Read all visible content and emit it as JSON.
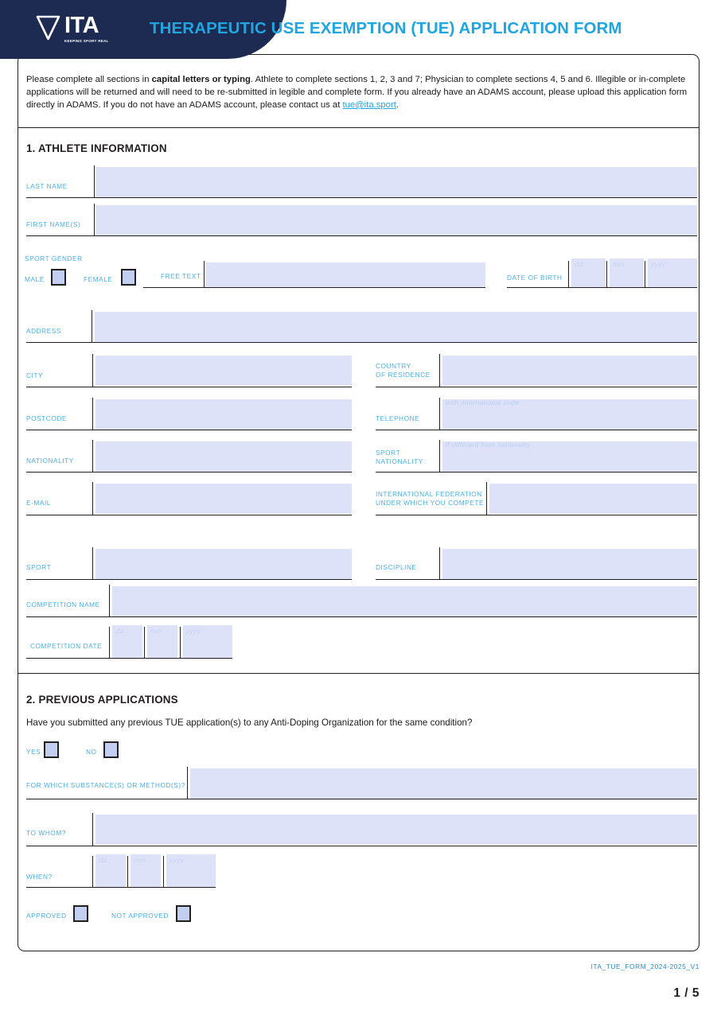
{
  "document": {
    "title": "THERAPEUTIC USE EXEMPTION (TUE) APPLICATION FORM",
    "logo_name": "ITA",
    "logo_tagline": "KEEPING SPORT REAL",
    "doc_code": "ITA_TUE_FORM_2024-2025_V1",
    "page_number": "1 / 5"
  },
  "colors": {
    "brand_navy": "#1d2b53",
    "accent_blue": "#1fa6e0",
    "label_blue": "#4aafe8",
    "field_fill": "#dde2f9",
    "checkbox_fill": "#c3cff1",
    "ink": "#231f20"
  },
  "instructions": {
    "part1": "Please complete all sections in ",
    "bold": "capital letters or typing",
    "part2": ". Athlete to complete sections 1, 2, 3 and 7; Physician to complete sections 4, 5 and 6. Illegible or in-complete applications will be returned and will need to be re-submitted in legible and complete form. If you already have an ADAMS account, please upload this application form directly in ADAMS. If you do not have an ADAMS account, please contact us at ",
    "email": "tue@ita.sport",
    "part3": "."
  },
  "section1": {
    "title": "1. ATHLETE INFORMATION",
    "last_name": {
      "label": "LAST NAME",
      "value": ""
    },
    "first_names": {
      "label": "FIRST NAME(S)",
      "value": ""
    },
    "sport_gender": {
      "label": "SPORT GENDER",
      "male": "MALE",
      "female": "FEMALE",
      "free_text_label": "FREE TEXT",
      "free_text_value": ""
    },
    "date_of_birth": {
      "label": "DATE OF BIRTH",
      "dd_placeholder": "dd",
      "mm_placeholder": "mm",
      "yyyy_placeholder": "yyyy",
      "dd": "",
      "mm": "",
      "yyyy": ""
    },
    "address": {
      "label": "ADDRESS",
      "value": ""
    },
    "city": {
      "label": "CITY",
      "value": ""
    },
    "country_of_residence": {
      "label": "COUNTRY\nOF RESIDENCE",
      "value": ""
    },
    "postcode": {
      "label": "POSTCODE",
      "value": ""
    },
    "telephone": {
      "label": "TELEPHONE",
      "hint": "with international code",
      "value": ""
    },
    "nationality": {
      "label": "NATIONALITY",
      "value": ""
    },
    "sport_nationality": {
      "label": "SPORT\nNATIONALITY",
      "hint": "if different from nationality",
      "value": ""
    },
    "email": {
      "label": "E-MAIL",
      "value": ""
    },
    "international_federation": {
      "label": "INTERNATIONAL FEDERATION\nUNDER WHICH YOU COMPETE",
      "value": ""
    },
    "sport": {
      "label": "SPORT",
      "value": ""
    },
    "discipline": {
      "label": "DISCIPLINE",
      "value": ""
    },
    "competition_name": {
      "label": "COMPETITION NAME",
      "value": ""
    },
    "competition_date": {
      "label": "COMPETITION DATE",
      "dd_placeholder": "dd",
      "mm_placeholder": "mm",
      "yyyy_placeholder": "yyyy",
      "dd": "",
      "mm": "",
      "yyyy": ""
    }
  },
  "section2": {
    "title": "2. PREVIOUS APPLICATIONS",
    "question": "Have you submitted any previous TUE application(s) to any Anti-Doping Organization for the same condition?",
    "yes": "YES",
    "no": "NO",
    "substance": {
      "label": "FOR WHICH SUBSTANCE(S) OR METHOD(S)?",
      "value": ""
    },
    "to_whom": {
      "label": "TO WHOM?",
      "value": ""
    },
    "when": {
      "label": "WHEN?",
      "dd_placeholder": "dd",
      "mm_placeholder": "mm",
      "yyyy_placeholder": "yyyy",
      "dd": "",
      "mm": "",
      "yyyy": ""
    },
    "approved": "APPROVED",
    "not_approved": "NOT APPROVED"
  }
}
